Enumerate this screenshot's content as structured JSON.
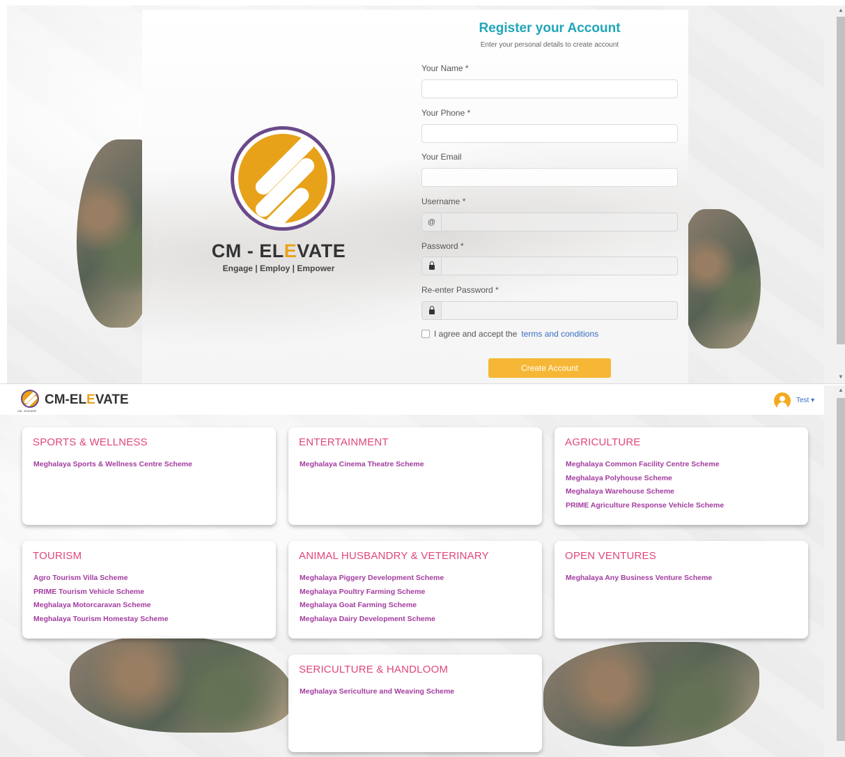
{
  "register": {
    "heading": "Register your Account",
    "subheading": "Enter your personal details to create account",
    "brand": {
      "prefix": "CM - EL",
      "accent": "E",
      "suffix": "VATE",
      "tagline": "Engage | Employ | Empower"
    },
    "fields": {
      "name_label": "Your Name *",
      "phone_label": "Your Phone *",
      "email_label": "Your Email",
      "username_label": "Username *",
      "username_addon": "@",
      "password_label": "Password *",
      "reenter_label": "Re-enter Password *"
    },
    "terms": {
      "prefix": "I agree and accept the",
      "link": "terms and conditions"
    },
    "submit_label": "Create Account"
  },
  "navbar": {
    "brand": {
      "prefix": "CM-EL",
      "accent": "E",
      "suffix": "VATE"
    },
    "logo_caption": "CM - ELEVATE",
    "user_label": "Test ▾"
  },
  "categories": [
    {
      "title": "SPORTS & WELLNESS",
      "schemes": [
        "Meghalaya Sports & Wellness Centre Scheme"
      ]
    },
    {
      "title": "ENTERTAINMENT",
      "schemes": [
        "Meghalaya Cinema Theatre Scheme"
      ]
    },
    {
      "title": "AGRICULTURE",
      "schemes": [
        "Meghalaya Common Facility Centre Scheme",
        "Meghalaya Polyhouse Scheme",
        "Meghalaya Warehouse Scheme",
        "PRIME Agriculture Response Vehicle Scheme"
      ]
    },
    {
      "title": "TOURISM",
      "schemes": [
        "Agro Tourism Villa Scheme",
        "PRIME Tourism Vehicle Scheme",
        "Meghalaya Motorcaravan Scheme",
        "Meghalaya Tourism Homestay Scheme"
      ]
    },
    {
      "title": "ANIMAL HUSBANDRY & VETERINARY",
      "schemes": [
        "Meghalaya Piggery Development Scheme",
        "Meghalaya Poultry Farming Scheme",
        "Meghalaya Goat Farming Scheme",
        "Meghalaya Dairy Development Scheme"
      ]
    },
    {
      "title": "OPEN VENTURES",
      "schemes": [
        "Meghalaya Any Business Venture Scheme"
      ]
    },
    {
      "title": "SERICULTURE & HANDLOOM",
      "schemes": [
        "Meghalaya Sericulture and Weaving Scheme"
      ]
    }
  ],
  "colors": {
    "heading_teal": "#1fa6b8",
    "brand_orange": "#e8a21a",
    "brand_purple": "#6a4a8a",
    "button_yellow": "#f6b736",
    "category_pink": "#e0467c",
    "scheme_purple": "#a23c9e",
    "link_blue": "#3a6fc4"
  },
  "icons": [
    "logo-icon",
    "at-icon",
    "lock-icon",
    "user-avatar-icon",
    "chevron-down-icon"
  ]
}
